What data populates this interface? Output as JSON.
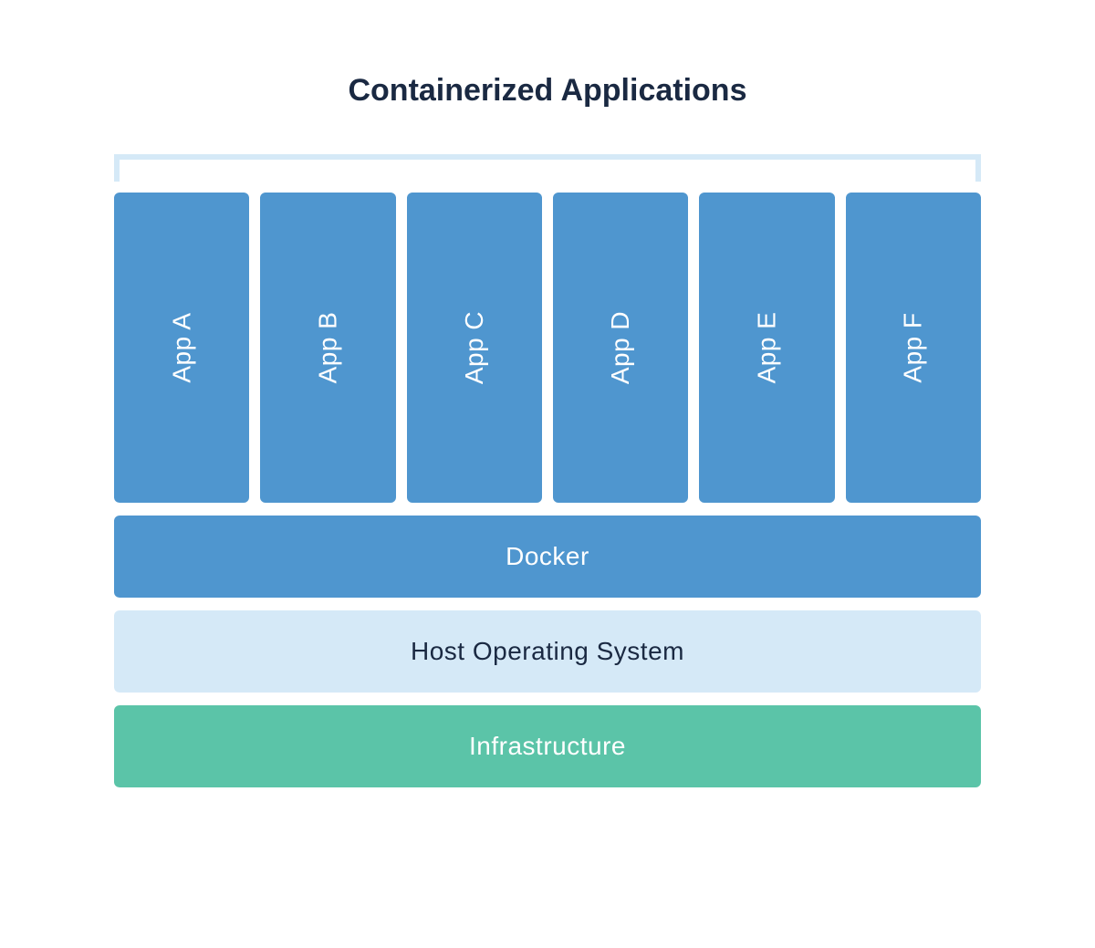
{
  "title": "Containerized Applications",
  "apps": [
    {
      "label": "App A"
    },
    {
      "label": "App B"
    },
    {
      "label": "App C"
    },
    {
      "label": "App D"
    },
    {
      "label": "App E"
    },
    {
      "label": "App F"
    }
  ],
  "layers": {
    "docker": "Docker",
    "host": "Host Operating System",
    "infrastructure": "Infrastructure"
  },
  "colors": {
    "app_bg": "#4f96cf",
    "docker_bg": "#4f96cf",
    "host_bg": "#d5e9f7",
    "infra_bg": "#5bc4a8",
    "bracket": "#d5e9f7",
    "title_text": "#1a2942"
  }
}
